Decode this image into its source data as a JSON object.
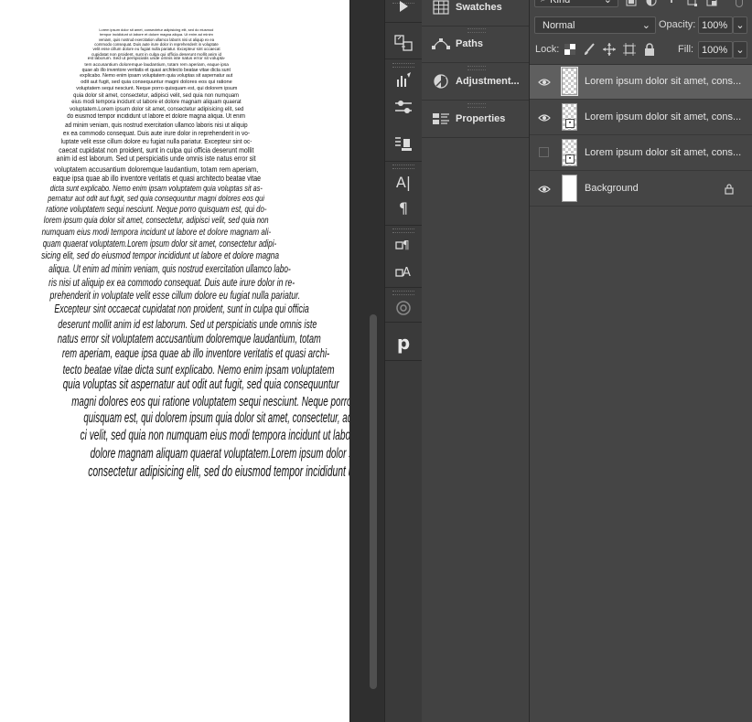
{
  "canvas": {
    "lines": [
      "Lorem ipsum dolor sit amet, consectetur adipisicing elit, sed do eiusmod",
      "tempor incididunt ut labore et dolore magna aliqua. Ut enim ad minim",
      "veniam, quis nostrud exercitation ullamco laboris nisi ut aliquip ex ea",
      "commodo consequat. Duis aute irure dolor in reprehenderit in voluptate",
      "velit esse cillum dolore eu fugiat nulla pariatur. Excepteur sint occaecat",
      "cupidatat non proident, sunt in culpa qui officia deserunt mollit anim id",
      "est laborum. Sed ut perspiciatis unde omnis iste natus error sit volupta-",
      "tem accusantium doloremque laudantium, totam rem aperiam, eaque ipsa",
      "quae ab illo inventore veritatis et quasi architecto beatae vitae dicta sunt",
      "explicabo. Nemo enim ipsam voluptatem quia voluptas sit aspernatur aut",
      "odit aut fugit, sed quia consequuntur magni dolores eos qui ratione",
      "voluptatem sequi nesciunt. Neque porro quisquam est, qui dolorem ipsum",
      "quia dolor sit amet, consectetur, adipisci velit, sed quia non numquam",
      "eius modi tempora incidunt ut labore et dolore magnam aliquam quaerat",
      "voluptatem.Lorem ipsum dolor sit amet, consectetur adipisicing elit, sed",
      "do eiusmod tempor incididunt ut labore et dolore magna aliqua. Ut enim",
      "ad minim veniam, quis nostrud exercitation ullamco laboris nisi ut aliquip",
      "ex ea commodo consequat. Duis aute irure dolor in reprehenderit in vo-",
      "luptate velit esse cillum dolore eu fugiat nulla pariatur. Excepteur sint oc-",
      "caecat cupidatat non proident, sunt in culpa qui officia deserunt mollit",
      "anim id est laborum. Sed ut perspiciatis unde omnis iste natus error sit",
      "voluptatem accusantium doloremque laudantium, totam rem aperiam,",
      "eaque ipsa quae ab illo inventore veritatis et quasi architecto beatae vitae",
      "dicta sunt explicabo. Nemo enim ipsam voluptatem quia voluptas sit as-",
      "pernatur aut odit aut fugit, sed quia consequuntur magni dolores eos qui",
      "ratione voluptatem sequi nesciunt. Neque porro quisquam est, qui do-",
      "lorem ipsum quia dolor sit amet, consectetur, adipisci velit, sed quia non",
      "numquam eius modi tempora incidunt ut labore et dolore magnam ali-",
      "quam quaerat voluptatem.Lorem ipsum dolor sit amet, consectetur adipi-",
      "sicing elit, sed do eiusmod tempor incididunt ut labore et dolore magna",
      "aliqua. Ut enim ad minim veniam, quis nostrud exercitation ullamco labo-",
      "ris nisi ut aliquip ex ea commodo consequat. Duis aute irure dolor in re-",
      "prehenderit in voluptate velit esse cillum dolore eu fugiat nulla pariatur.",
      "Excepteur sint occaecat cupidatat non proident, sunt in culpa qui officia",
      "deserunt mollit anim id est laborum. Sed ut perspiciatis unde omnis iste",
      "natus error sit voluptatem accusantium doloremque laudantium, totam",
      "rem aperiam, eaque ipsa quae ab illo inventore veritatis et quasi archi-",
      "tecto beatae vitae dicta sunt explicabo. Nemo enim ipsam voluptatem",
      "quia voluptas sit aspernatur aut odit aut fugit, sed quia consequuntur",
      "magni dolores eos qui ratione voluptatem sequi nesciunt. Neque porro",
      "quisquam est, qui dolorem ipsum quia dolor sit amet, consectetur, adipis-",
      "ci velit, sed quia non numquam eius modi tempora incidunt ut labore et",
      "dolore magnam aliquam quaerat voluptatem.Lorem ipsum dolor sit amet,",
      "consectetur adipisicing elit, sed do eiusmod tempor incididunt ut labore"
    ]
  },
  "panels": [
    {
      "label": "Swatches",
      "icon": "swatches-grid-icon"
    },
    {
      "label": "Paths",
      "icon": "paths-icon"
    },
    {
      "label": "Adjustment...",
      "icon": "adjustment-circle-icon"
    },
    {
      "label": "Properties",
      "icon": "properties-icon"
    }
  ],
  "layers_panel": {
    "filter_kind": "Kind",
    "blend_mode": "Normal",
    "opacity_label": "Opacity:",
    "opacity_value": "100%",
    "lock_label": "Lock:",
    "fill_label": "Fill:",
    "fill_value": "100%",
    "layers": [
      {
        "name": "Lorem ipsum dolor sit amet, cons...",
        "visible": true,
        "selected": true
      },
      {
        "name": "Lorem ipsum dolor sit amet, cons...",
        "visible": true,
        "selected": false
      },
      {
        "name": "Lorem ipsum dolor sit amet, cons...",
        "visible": false,
        "selected": false
      },
      {
        "name": "Background",
        "visible": true,
        "selected": false,
        "locked": true
      }
    ]
  }
}
